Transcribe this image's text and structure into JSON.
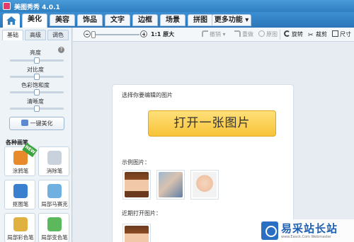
{
  "window": {
    "title": "美图秀秀 4.0.1"
  },
  "main_tabs": [
    {
      "label": "美化"
    },
    {
      "label": "美容"
    },
    {
      "label": "饰品"
    },
    {
      "label": "文字"
    },
    {
      "label": "边框"
    },
    {
      "label": "场景"
    },
    {
      "label": "拼图"
    },
    {
      "label": "更多功能 ▾"
    }
  ],
  "left_panel": {
    "sub_tabs": [
      {
        "label": "基础"
      },
      {
        "label": "高级"
      },
      {
        "label": "调色"
      }
    ],
    "adjustments": [
      {
        "label": "亮度",
        "level": 0.5
      },
      {
        "label": "对比度",
        "level": 0.5
      },
      {
        "label": "色彩饱和度",
        "level": 0.5
      },
      {
        "label": "清晰度",
        "level": 0.5
      }
    ],
    "one_key_label": "一键美化",
    "section_title": "各种画笔",
    "new_badge": "NEW",
    "brushes": [
      {
        "label": "涂鸦笔",
        "icon": "pencil-icon",
        "color": "#e8892a"
      },
      {
        "label": "消除笔",
        "icon": "eraser-icon",
        "color": "#c9d2dc"
      },
      {
        "label": "抠图笔",
        "icon": "pen-icon",
        "color": "#3b7fcf"
      },
      {
        "label": "局部马赛克",
        "icon": "mosaic-icon",
        "color": "#6fb0e0"
      },
      {
        "label": "局部彩色笔",
        "icon": "brush-icon",
        "color": "#e0b040"
      },
      {
        "label": "局部变色笔",
        "icon": "color-brush-icon",
        "color": "#5cb85c"
      }
    ]
  },
  "toolbar": {
    "actual_size": "1:1 原大",
    "undo": "撤销",
    "redo": "重做",
    "original": "原图",
    "rotate": "旋转",
    "crop": "裁剪",
    "resize": "尺寸"
  },
  "canvas": {
    "prompt": "选择你要编辑的图片",
    "open_button": "打开一张图片",
    "sample_label": "示例图片：",
    "recent_label": "近期打开图片："
  },
  "watermark": {
    "text": "易采站长站",
    "subtext": "www.Easck.Com Webmaster"
  }
}
